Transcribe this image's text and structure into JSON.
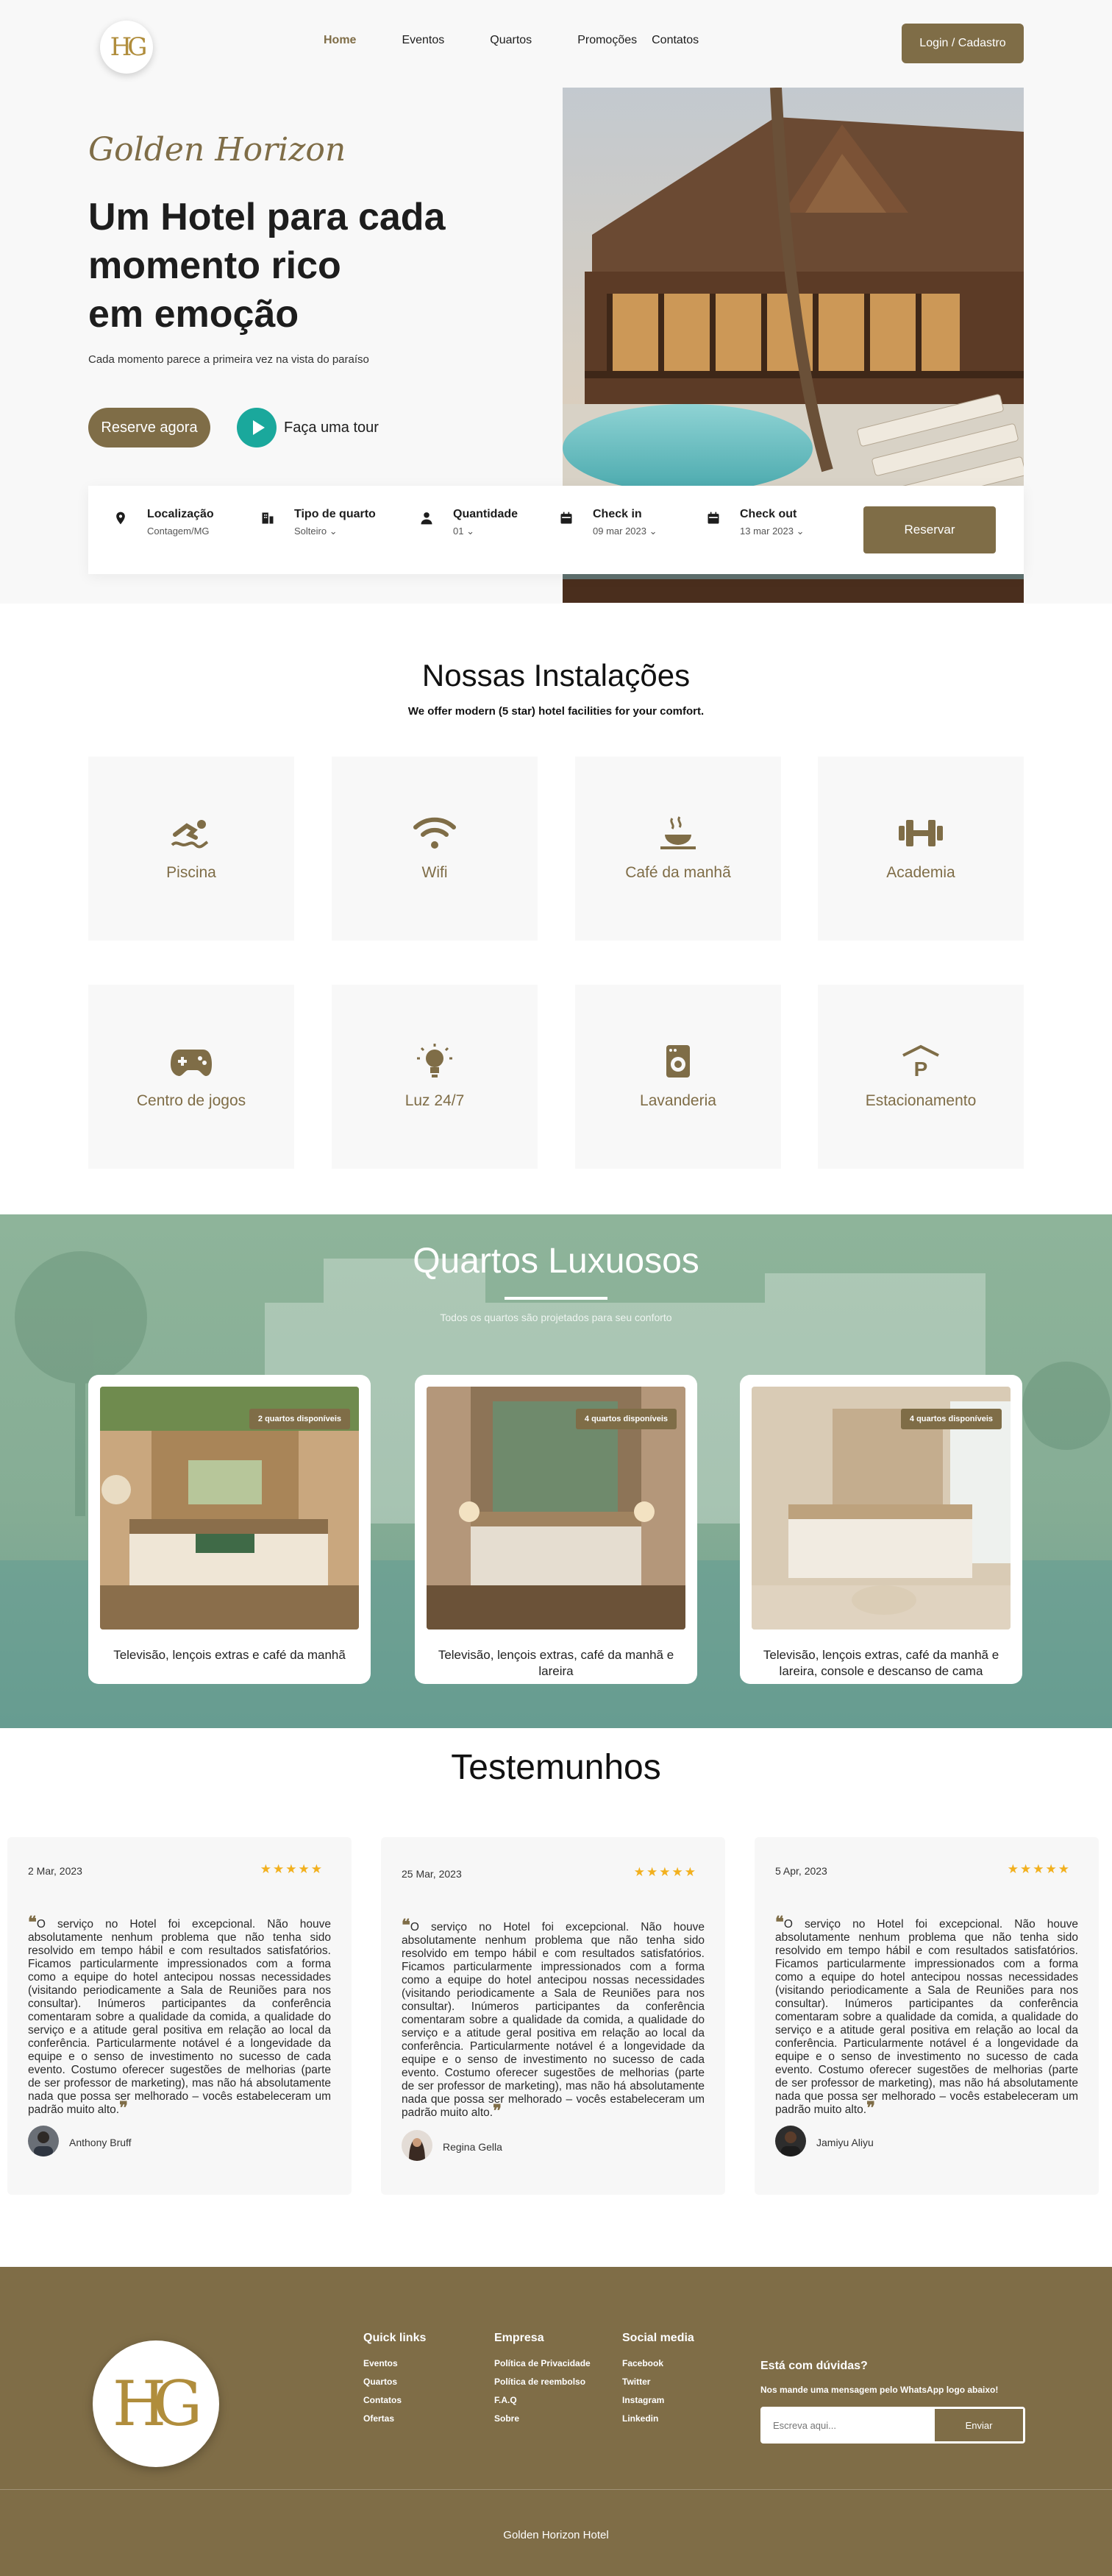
{
  "nav": {
    "logo_text": "HG",
    "items": [
      {
        "label": "Home",
        "active": true
      },
      {
        "label": "Eventos"
      },
      {
        "label": "Quartos"
      },
      {
        "label": "Promoções"
      },
      {
        "label": "Contatos"
      }
    ],
    "login_label": "Login / Cadastro"
  },
  "hero": {
    "script_title": "Golden Horizon",
    "headline_1": "Um Hotel para cada",
    "headline_2": "momento rico",
    "headline_3": "em emoção",
    "subtitle": "Cada momento parece a primeira vez na vista do paraíso",
    "reserve_label": "Reserve agora",
    "tour_label": "Faça uma tour"
  },
  "booking": {
    "location_label": "Localização",
    "location_value": "Contagem/MG",
    "room_label": "Tipo de quarto",
    "room_value": "Solteiro",
    "qty_label": "Quantidade",
    "qty_value": "01",
    "checkin_label": "Check in",
    "checkin_value": "09 mar 2023",
    "checkout_label": "Check out",
    "checkout_value": "13 mar 2023",
    "submit_label": "Reservar"
  },
  "facilities": {
    "title": "Nossas Instalações",
    "subtitle": "We offer modern (5 star) hotel facilities for your comfort.",
    "items": [
      {
        "label": "Piscina",
        "icon": "swimming-icon"
      },
      {
        "label": "Wifi",
        "icon": "wifi-icon"
      },
      {
        "label": "Café da manhã",
        "icon": "breakfast-icon"
      },
      {
        "label": "Academia",
        "icon": "dumbbell-icon"
      },
      {
        "label": "Centro de jogos",
        "icon": "gamepad-icon"
      },
      {
        "label": "Luz 24/7",
        "icon": "lightbulb-icon"
      },
      {
        "label": "Lavanderia",
        "icon": "laundry-icon"
      },
      {
        "label": "Estacionamento",
        "icon": "parking-icon"
      }
    ]
  },
  "rooms": {
    "title": "Quartos Luxuosos",
    "subtitle": "Todos os quartos são projetados para seu conforto",
    "items": [
      {
        "badge": "2 quartos disponíveis",
        "desc": "Televisão, lençois extras e café da manhã"
      },
      {
        "badge": "4 quartos disponíveis",
        "desc": "Televisão, lençois extras, café da manhã e lareira"
      },
      {
        "badge": "4 quartos disponíveis",
        "desc": "Televisão, lençois extras, café da manhã e lareira, console e descanso de cama"
      }
    ]
  },
  "testimonials": {
    "title": "Testemunhos",
    "items": [
      {
        "date": "2 Mar, 2023",
        "stars": "★★★★★",
        "name": "Anthony Bruff",
        "text": "O serviço no Hotel foi excepcional. Não houve absolutamente nenhum problema que não tenha sido resolvido em tempo hábil e com resultados satisfatórios. Ficamos particularmente impressionados com a forma como a equipe do hotel antecipou nossas necessidades (visitando periodicamente a Sala de Reuniões para nos consultar). Inúmeros participantes da conferência comentaram sobre a qualidade da comida, a qualidade do serviço e a atitude geral positiva em relação ao local da conferência. Particularmente notável é a longevidade da equipe e o senso de investimento no sucesso de cada evento. Costumo oferecer sugestões de melhorias (parte de ser professor de marketing), mas não há absolutamente nada que possa ser melhorado – vocês estabeleceram um padrão muito alto."
      },
      {
        "date": "25 Mar, 2023",
        "stars": "★★★★★",
        "name": "Regina Gella",
        "text": "O serviço no Hotel  foi excepcional. Não houve absolutamente nenhum problema que não tenha sido resolvido em tempo hábil e com resultados satisfatórios. Ficamos particularmente impressionados com a forma como a equipe do hotel antecipou nossas necessidades (visitando periodicamente a Sala de Reuniões para nos consultar). Inúmeros participantes da conferência comentaram sobre a qualidade da comida, a qualidade do serviço e a atitude geral positiva em relação ao local da conferência. Particularmente notável é a longevidade da equipe e o senso de investimento no sucesso de cada evento. Costumo oferecer sugestões de melhorias (parte de ser professor de marketing), mas não há absolutamente nada que possa ser melhorado – vocês estabeleceram um padrão muito alto."
      },
      {
        "date": "5 Apr, 2023",
        "stars": "★★★★★",
        "name": "Jamiyu Aliyu",
        "text": "O serviço no Hotel  foi excepcional. Não houve absolutamente nenhum problema que não tenha sido resolvido em tempo hábil e com resultados satisfatórios. Ficamos particularmente impressionados com a forma como a equipe do hotel antecipou nossas necessidades (visitando periodicamente a Sala de Reuniões para nos consultar). Inúmeros participantes da conferência comentaram sobre a qualidade da comida, a qualidade do serviço e a atitude geral positiva em relação ao local da conferência. Particularmente notável é a longevidade da equipe e o senso de investimento no sucesso de cada evento. Costumo oferecer sugestões de melhorias (parte de ser professor de marketing), mas não há absolutamente nada que possa ser melhorado – vocês estabeleceram um padrão muito alto."
      }
    ]
  },
  "footer": {
    "logo_text": "HG",
    "quick_title": "Quick links",
    "quick_links": [
      "Eventos",
      "Quartos",
      "Contatos",
      "Ofertas"
    ],
    "company_title": "Empresa",
    "company_links": [
      "Política de Privacidade",
      "Política de reembolso",
      "F.A.Q",
      "Sobre"
    ],
    "social_title": "Social media",
    "social_links": [
      "Facebook",
      "Twitter",
      "Instagram",
      "Linkedin"
    ],
    "contact_title": "Está com dúvidas?",
    "contact_text": "Nos mande uma mensagem pelo WhatsApp logo abaixo!",
    "input_placeholder": "Escreva aqui...",
    "send_label": "Enviar",
    "copyright": "Golden Horizon Hotel"
  },
  "colors": {
    "brand": "#7f6d47",
    "accent": "#1aa89c",
    "star": "#f2b01e"
  }
}
